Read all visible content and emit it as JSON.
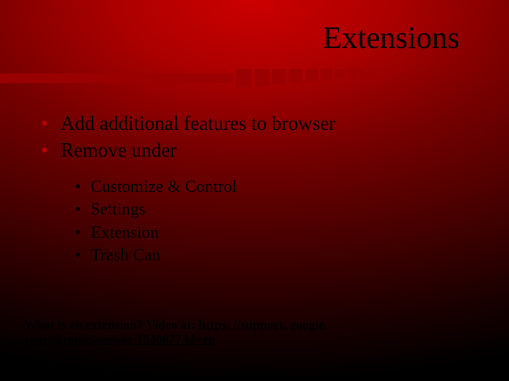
{
  "title": "Extensions",
  "bullets": [
    "Add additional features to browser",
    "Remove under"
  ],
  "sub_bullets": [
    "Customize & Control",
    "Settings",
    "Extension",
    "Trash Can"
  ],
  "footer": {
    "label": "What is an extension? Video at: ",
    "link": "https: //support. google. com/chrome/answer/154007? hl=en"
  }
}
